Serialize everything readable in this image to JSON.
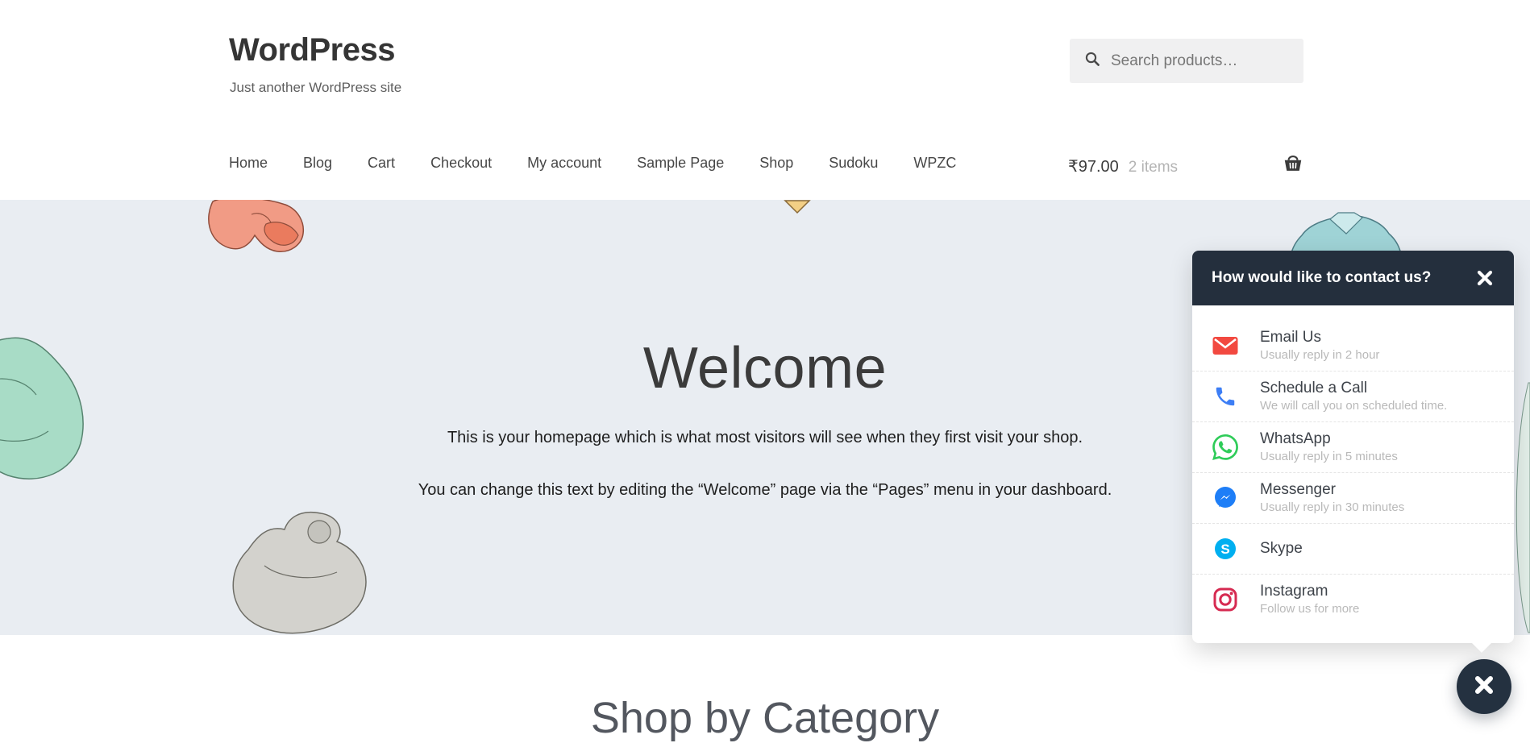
{
  "site": {
    "title": "WordPress",
    "tagline": "Just another WordPress site"
  },
  "search": {
    "placeholder": "Search products…"
  },
  "nav": {
    "items": [
      "Home",
      "Blog",
      "Cart",
      "Checkout",
      "My account",
      "Sample Page",
      "Shop",
      "Sudoku",
      "WPZC"
    ],
    "cart": {
      "amount": "₹97.00",
      "count": "2 items"
    }
  },
  "hero": {
    "heading": "Welcome",
    "paragraph1": "This is your homepage which is what most visitors will see when they first visit your shop.",
    "paragraph2": "You can change this text by editing the “Welcome” page via the “Pages” menu in your dashboard."
  },
  "shop_section": {
    "heading": "Shop by Category"
  },
  "contact_widget": {
    "title": "How would like to contact us?",
    "items": [
      {
        "icon": "email-icon",
        "label": "Email Us",
        "subtitle": "Usually reply in 2 hour",
        "color": "#f24940"
      },
      {
        "icon": "phone-icon",
        "label": "Schedule a Call",
        "subtitle": "We will call you on scheduled time.",
        "color": "#3d7ef5"
      },
      {
        "icon": "whatsapp-icon",
        "label": "WhatsApp",
        "subtitle": "Usually reply in 5 minutes",
        "color": "#2fcc59"
      },
      {
        "icon": "messenger-icon",
        "label": "Messenger",
        "subtitle": "Usually reply in 30 minutes",
        "color": "#1e7ef7"
      },
      {
        "icon": "skype-icon",
        "label": "Skype",
        "subtitle": "",
        "color": "#00aff0"
      },
      {
        "icon": "instagram-icon",
        "label": "Instagram",
        "subtitle": "Follow us for more",
        "color": "#d62a51"
      }
    ]
  },
  "colors": {
    "hero_background": "#e9edf2",
    "widget_header": "#242f3d",
    "floating_button": "#243140"
  }
}
